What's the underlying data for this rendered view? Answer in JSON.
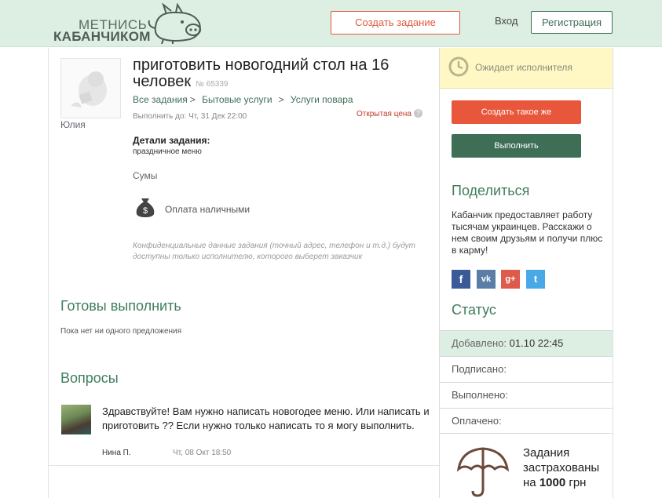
{
  "header": {
    "logo_line1": "МЕТНИСЬ",
    "logo_line2": "КАБАНЧИКОМ",
    "create_task_label": "Создать задание",
    "login_label": "Вход",
    "register_label": "Регистрация"
  },
  "task": {
    "author": "Юлия",
    "title": "приготовить новогодний стол на 16 человек",
    "number": "№ 65339",
    "breadcrumbs": [
      "Все задания",
      "Бытовые услуги",
      "Услуги повара"
    ],
    "deadline": "Выполнить до: Чт, 31 Дек 22:00",
    "price_type": "Открытая цена",
    "details_label": "Детали задания:",
    "details_text": "праздничное меню",
    "city": "Сумы",
    "payment": "Оплата наличными",
    "confidential_note": "Конфиденциальные данные задания (точный адрес, телефон и т.д.) будут доступны только исполнителю, которого выберет заказчик"
  },
  "offers": {
    "title": "Готовы выполнить",
    "empty_text": "Пока нет ни одного предложения"
  },
  "questions": {
    "title": "Вопросы",
    "items": [
      {
        "text": "Здравствуйте! Вам нужно написать новогодее меню. Или написать и приготовить ?? Если нужно только написать то я могу выполнить.",
        "author": "Нина П.",
        "date": "Чт, 08 Окт 18:50"
      }
    ]
  },
  "sidebar": {
    "status": "Ожидает исполнителя",
    "create_same_label": "Создать такое же",
    "do_label": "Выполнить",
    "share_title": "Поделиться",
    "share_text": "Кабанчик предоставляет работу тысячам украинцев. Расскажи о нем своим друзьям и получи плюс в карму!",
    "social": [
      "f",
      "vk",
      "g+",
      "t"
    ],
    "status_title": "Статус",
    "added_label": "Добавлено:",
    "added_value": "01.10 22:45",
    "signed_label": "Подписано:",
    "done_label": "Выполнено:",
    "paid_label": "Оплачено:",
    "insured_line1": "Задания застрахованы на",
    "insured_amount": "1000",
    "insured_currency": "грн"
  },
  "colors": {
    "header_bg": "#ddeee3",
    "accent_red": "#e8563b",
    "accent_green": "#3f6e57",
    "status_yellow": "#fff8c4"
  },
  "icons": [
    "pig-logo-icon",
    "money-bag-icon",
    "clock-icon",
    "umbrella-icon",
    "help-icon",
    "facebook-icon",
    "vk-icon",
    "googleplus-icon",
    "twitter-icon"
  ]
}
